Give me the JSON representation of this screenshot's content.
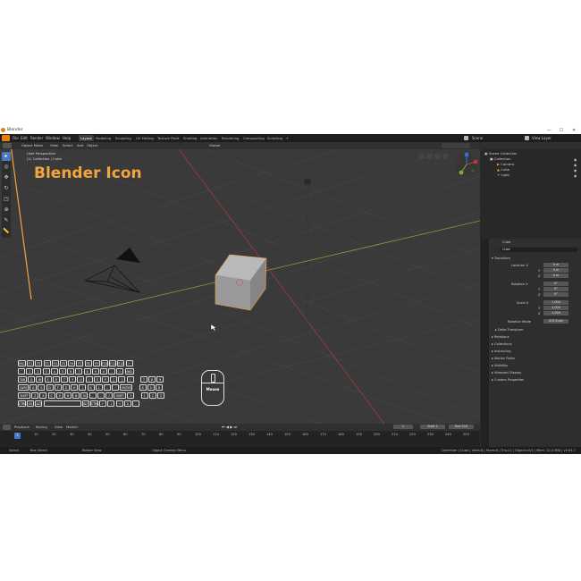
{
  "window": {
    "title": "Blender",
    "controls": [
      "—",
      "☐",
      "✕"
    ]
  },
  "menubar": {
    "items": [
      "File",
      "Edit",
      "Render",
      "Window",
      "Help"
    ],
    "workspaces": [
      "Layout",
      "Modeling",
      "Sculpting",
      "UV Editing",
      "Texture Paint",
      "Shading",
      "Animation",
      "Rendering",
      "Compositing",
      "Scripting"
    ],
    "active_workspace": "Layout",
    "add_tab": "+",
    "scene_label": "Scene",
    "view_layer_label": "View Layer"
  },
  "viewport_header": {
    "mode": "Object Mode",
    "menus": [
      "View",
      "Select",
      "Add",
      "Object"
    ],
    "transform": "Global"
  },
  "viewport": {
    "overlay_line1": "User Perspective",
    "overlay_line2": "(1) Collection | Cube",
    "mouse_label": "Mouse"
  },
  "annotation": {
    "text": "Blender Icon",
    "color": "#f3a43a"
  },
  "outliner": {
    "root": "Scene Collection",
    "items": [
      "Collection",
      "Camera",
      "Cube",
      "Light"
    ]
  },
  "properties": {
    "object_name": "Cube",
    "object_field": "Cube",
    "section_transform": "Transform",
    "location_label": "Location X",
    "location_values": [
      "0 m",
      "0 m",
      "0 m"
    ],
    "rotation_label": "Rotation X",
    "rotation_values": [
      "0°",
      "0°",
      "0°"
    ],
    "scale_label": "Scale X",
    "scale_values": [
      "1.000",
      "1.000",
      "1.000"
    ],
    "axis_y": "Y",
    "axis_z": "Z",
    "rotation_mode_label": "Rotation Mode",
    "rotation_mode_value": "XYZ Euler",
    "sections": [
      "Delta Transform",
      "Relations",
      "Collections",
      "Instancing",
      "Motion Paths",
      "Visibility",
      "Viewport Display",
      "Custom Properties"
    ]
  },
  "timeline": {
    "menus": [
      "Playback",
      "Keying",
      "View",
      "Marker"
    ],
    "current_frame": "1",
    "start_label": "Start",
    "start_value": "1",
    "end_label": "End",
    "end_value": "250",
    "ticks": [
      "0",
      "10",
      "20",
      "30",
      "40",
      "50",
      "60",
      "70",
      "80",
      "90",
      "100",
      "110",
      "120",
      "130",
      "140",
      "150",
      "160",
      "170",
      "180",
      "190",
      "200",
      "210",
      "220",
      "230",
      "240",
      "250"
    ]
  },
  "statusbar": {
    "left": [
      "Select",
      "Box Select",
      "Rotate View",
      "Object Context Menu"
    ],
    "right": "Collection | Cube | Verts:8 | Faces:6 | Tris:12 | Objects:0/3 | Mem: 22.0 MiB | v2.83.7"
  },
  "keyboard": {
    "row1": [
      "ESC",
      "F1",
      "F2",
      "F3",
      "F4",
      "F5",
      "F6",
      "F7",
      "F8",
      "F9",
      "F10",
      "F11",
      "F12",
      "←"
    ],
    "row2": [
      "`",
      "1",
      "2",
      "3",
      "4",
      "5",
      "6",
      "7",
      "8",
      "9",
      "0",
      "-",
      "=",
      "BKS"
    ],
    "row3": [
      "TAB",
      "Q",
      "W",
      "E",
      "R",
      "T",
      "Y",
      "U",
      "I",
      "O",
      "P",
      "[",
      "]",
      "\\",
      "7",
      "8",
      "9"
    ],
    "row4": [
      "CAPS",
      "A",
      "S",
      "D",
      "F",
      "G",
      "H",
      "J",
      "K",
      "L",
      ";",
      "'",
      "ENTER",
      "4",
      "5",
      "6"
    ],
    "row5": [
      "SHIFT",
      "Z",
      "X",
      "C",
      "V",
      "B",
      "N",
      "M",
      ",",
      ".",
      "/",
      "SHIFT",
      "↑",
      "1",
      "2",
      "3"
    ],
    "row6": [
      "CTRL",
      "OS",
      "ALT",
      "",
      "ALT",
      "CTRL",
      "←",
      "↓",
      "→",
      "0",
      "."
    ]
  },
  "colors": {
    "accent_blue": "#4a79c4",
    "selection_orange": "#f3a43a",
    "axis_red": "#c0392b",
    "axis_green": "#7fae2e"
  }
}
